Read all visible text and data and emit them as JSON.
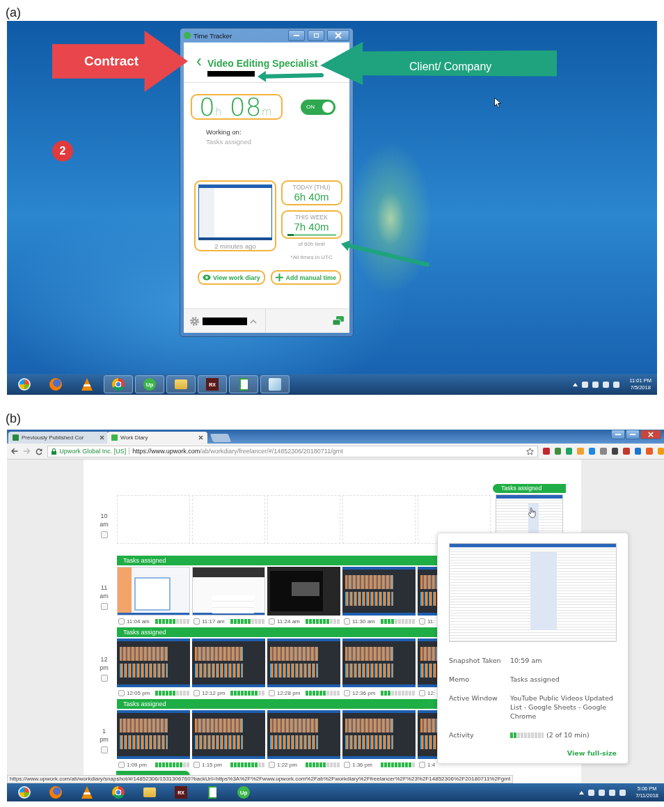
{
  "panel_a": {
    "label": "(a)",
    "annotations": [
      {
        "kind": "arrow-right",
        "label": "Contract",
        "color": "#e8464b"
      },
      {
        "kind": "arrow-left",
        "label": "Client/ Company",
        "color": "#1fa37e"
      },
      {
        "kind": "pointer",
        "color": "#1fa37e"
      },
      {
        "kind": "pointer",
        "color": "#1fa37e"
      },
      {
        "kind": "badge",
        "label": "2",
        "color": "#e0393e"
      }
    ],
    "time_tracker": {
      "title": "Time Tracker",
      "job_title": "Video Editing Specialist",
      "timer": "0$_{h}$ 08$_{m}$",
      "tracking": {
        "label": "ON",
        "on": true
      },
      "working_on_label": "Working on:",
      "working_on": "Tasks assigned",
      "last_screenshot": "2 minutes ago",
      "today_label": "TODAY (THU)",
      "today": "6h 40m",
      "week_label": "THIS WEEK",
      "week": "7h 40m",
      "week_limit": {
        "level": 0.13,
        "caption": "of 60h limit"
      },
      "timezone_note": "*All times in UTC",
      "buttons": [
        {
          "kind": "view",
          "label": "View work diary"
        },
        {
          "kind": "add",
          "label": "Add manual time"
        }
      ]
    },
    "taskbar": {
      "apps": [
        {
          "kind": "start",
          "running": false
        },
        {
          "kind": "firefox",
          "running": false
        },
        {
          "kind": "vlc",
          "running": false
        },
        {
          "kind": "chrome",
          "running": true
        },
        {
          "kind": "upwork",
          "label": "Up",
          "running": true
        },
        {
          "kind": "folder",
          "running": true
        },
        {
          "kind": "rx",
          "label": "RX",
          "running": true
        },
        {
          "kind": "camtasia",
          "running": true
        },
        {
          "kind": "notepad",
          "running": true
        }
      ],
      "clock": {
        "time": "11:01 PM",
        "date": "7/5/2018"
      }
    }
  },
  "panel_b": {
    "label": "(b)",
    "browser": {
      "tabs": [
        {
          "kind": "sheet",
          "title": "Previously Published Cor",
          "selected": false
        },
        {
          "kind": "upwork",
          "title": "Work Diary",
          "selected": true
        }
      ],
      "site_identity": "Upwork Global Inc. [US]",
      "url_host": "https://www.upwork.com",
      "url_path": "/ab/workdiary/freelancer/#/14852306/20180711/gmt",
      "status_url": "https://www.upwork.com/ab/workdiary/snapshot/#/14852306/1531306760?backUrl=https%3A%2F%2Fwww.upwork.com%2Fab%2Fworkdiary%2Ffreelancer%2F%23%2F14852306%2F20180711%2Fgmt"
    },
    "work_diary": {
      "hours": [
        {
          "hour": "10",
          "period": "am",
          "checked": false,
          "snapshots": [
            {
              "kind": "empty"
            },
            {
              "kind": "empty"
            },
            {
              "kind": "empty"
            },
            {
              "kind": "empty"
            },
            {
              "kind": "empty"
            },
            {
              "kind": "sheet",
              "memo": "Tasks assigned"
            }
          ]
        },
        {
          "hour": "11",
          "period": "am",
          "checked": false,
          "memo": "Tasks assigned",
          "snapshots": [
            {
              "kind": "document",
              "time": "11:04 am",
              "checked": false,
              "level": 0.6
            },
            {
              "kind": "web",
              "time": "11:17 am",
              "checked": false,
              "level": 0.6
            },
            {
              "kind": "dark",
              "time": "11:24 am",
              "checked": false,
              "level": 0.7
            },
            {
              "kind": "audio",
              "time": "11:30 am",
              "checked": false,
              "level": 0.4
            },
            {
              "kind": "audio",
              "time": "11:",
              "checked": false
            }
          ]
        },
        {
          "hour": "12",
          "period": "pm",
          "checked": false,
          "memo": "Tasks assigned",
          "snapshots": [
            {
              "kind": "audio",
              "time": "12:05 pm",
              "checked": false,
              "level": 0.6
            },
            {
              "kind": "audio",
              "time": "12:12 pm",
              "checked": false,
              "level": 0.8
            },
            {
              "kind": "audio",
              "time": "12:28 pm",
              "checked": false,
              "level": 0.6
            },
            {
              "kind": "audio",
              "time": "12:36 pm",
              "checked": false,
              "level": 0.3
            },
            {
              "kind": "audio",
              "time": "12:",
              "checked": false
            }
          ]
        },
        {
          "hour": "1",
          "period": "pm",
          "checked": false,
          "memo": "Tasks assigned",
          "snapshots": [
            {
              "kind": "audio",
              "time": "1:09 pm",
              "checked": false,
              "level": 0.8
            },
            {
              "kind": "audio",
              "time": "1:15 pm",
              "checked": false,
              "level": 0.8
            },
            {
              "kind": "audio",
              "time": "1:22 pm",
              "checked": false,
              "level": 0.6
            },
            {
              "kind": "audio",
              "time": "1:36 pm",
              "checked": false,
              "level": 0.9
            },
            {
              "kind": "audio",
              "time": "1:4",
              "checked": false
            }
          ]
        }
      ],
      "popup": {
        "details": [
          {
            "kind": "text",
            "label": "Snapshot Taken",
            "value": "10:59 am"
          },
          {
            "kind": "text",
            "label": "Memo",
            "value": "Tasks assigned"
          },
          {
            "kind": "text",
            "label": "Active Window",
            "value": "YouTube Public Videos Updated List - Google Sheets - Google Chrome"
          },
          {
            "kind": "meter",
            "label": "Activity",
            "level": 0.2,
            "value": "(2 of 10 min)"
          }
        ],
        "link": "View full-size"
      }
    },
    "taskbar": {
      "apps": [
        {
          "kind": "start",
          "running": false
        },
        {
          "kind": "firefox",
          "running": false
        },
        {
          "kind": "vlc",
          "running": false
        },
        {
          "kind": "chrome",
          "running": false
        },
        {
          "kind": "folder",
          "running": false
        },
        {
          "kind": "rx",
          "label": "RX",
          "running": false
        },
        {
          "kind": "camtasia",
          "running": false
        },
        {
          "kind": "upwork",
          "label": "Up",
          "running": false
        }
      ],
      "clock": {
        "time": "5:06 PM",
        "date": "7/11/2018"
      }
    }
  }
}
